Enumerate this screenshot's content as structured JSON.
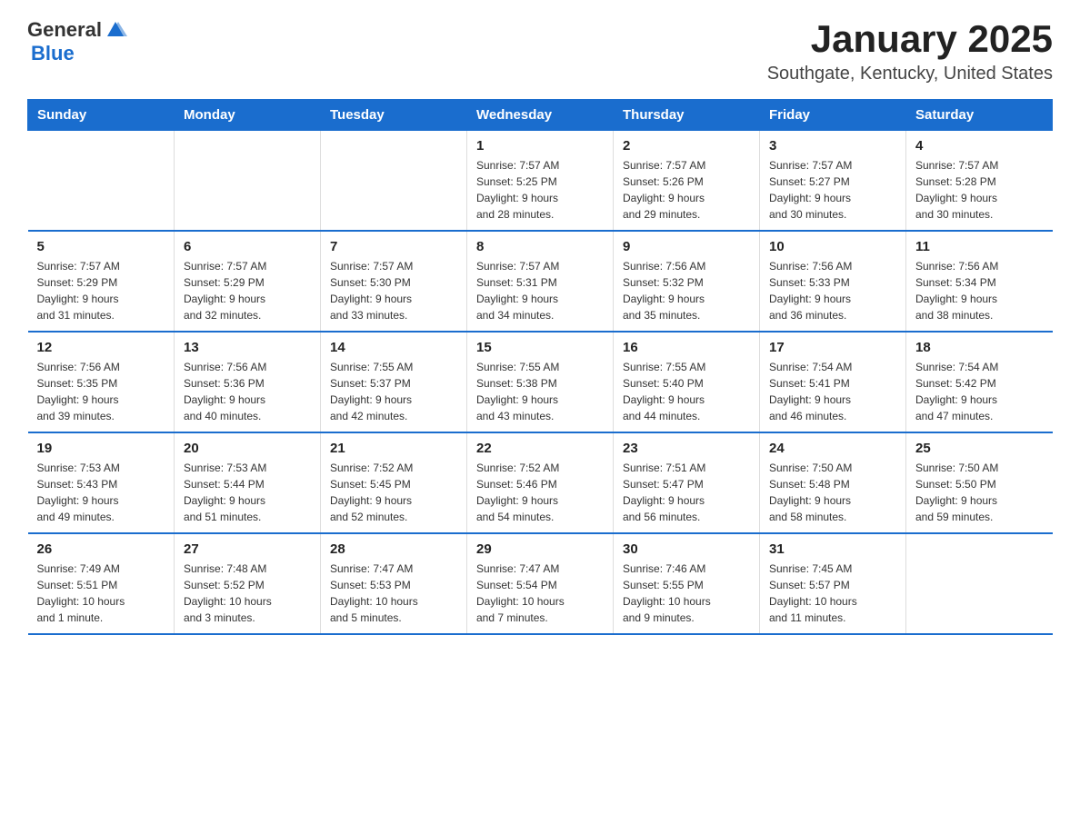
{
  "header": {
    "logo_general": "General",
    "logo_blue": "Blue",
    "title": "January 2025",
    "subtitle": "Southgate, Kentucky, United States"
  },
  "days_of_week": [
    "Sunday",
    "Monday",
    "Tuesday",
    "Wednesday",
    "Thursday",
    "Friday",
    "Saturday"
  ],
  "weeks": [
    [
      {
        "day": "",
        "info": ""
      },
      {
        "day": "",
        "info": ""
      },
      {
        "day": "",
        "info": ""
      },
      {
        "day": "1",
        "info": "Sunrise: 7:57 AM\nSunset: 5:25 PM\nDaylight: 9 hours\nand 28 minutes."
      },
      {
        "day": "2",
        "info": "Sunrise: 7:57 AM\nSunset: 5:26 PM\nDaylight: 9 hours\nand 29 minutes."
      },
      {
        "day": "3",
        "info": "Sunrise: 7:57 AM\nSunset: 5:27 PM\nDaylight: 9 hours\nand 30 minutes."
      },
      {
        "day": "4",
        "info": "Sunrise: 7:57 AM\nSunset: 5:28 PM\nDaylight: 9 hours\nand 30 minutes."
      }
    ],
    [
      {
        "day": "5",
        "info": "Sunrise: 7:57 AM\nSunset: 5:29 PM\nDaylight: 9 hours\nand 31 minutes."
      },
      {
        "day": "6",
        "info": "Sunrise: 7:57 AM\nSunset: 5:29 PM\nDaylight: 9 hours\nand 32 minutes."
      },
      {
        "day": "7",
        "info": "Sunrise: 7:57 AM\nSunset: 5:30 PM\nDaylight: 9 hours\nand 33 minutes."
      },
      {
        "day": "8",
        "info": "Sunrise: 7:57 AM\nSunset: 5:31 PM\nDaylight: 9 hours\nand 34 minutes."
      },
      {
        "day": "9",
        "info": "Sunrise: 7:56 AM\nSunset: 5:32 PM\nDaylight: 9 hours\nand 35 minutes."
      },
      {
        "day": "10",
        "info": "Sunrise: 7:56 AM\nSunset: 5:33 PM\nDaylight: 9 hours\nand 36 minutes."
      },
      {
        "day": "11",
        "info": "Sunrise: 7:56 AM\nSunset: 5:34 PM\nDaylight: 9 hours\nand 38 minutes."
      }
    ],
    [
      {
        "day": "12",
        "info": "Sunrise: 7:56 AM\nSunset: 5:35 PM\nDaylight: 9 hours\nand 39 minutes."
      },
      {
        "day": "13",
        "info": "Sunrise: 7:56 AM\nSunset: 5:36 PM\nDaylight: 9 hours\nand 40 minutes."
      },
      {
        "day": "14",
        "info": "Sunrise: 7:55 AM\nSunset: 5:37 PM\nDaylight: 9 hours\nand 42 minutes."
      },
      {
        "day": "15",
        "info": "Sunrise: 7:55 AM\nSunset: 5:38 PM\nDaylight: 9 hours\nand 43 minutes."
      },
      {
        "day": "16",
        "info": "Sunrise: 7:55 AM\nSunset: 5:40 PM\nDaylight: 9 hours\nand 44 minutes."
      },
      {
        "day": "17",
        "info": "Sunrise: 7:54 AM\nSunset: 5:41 PM\nDaylight: 9 hours\nand 46 minutes."
      },
      {
        "day": "18",
        "info": "Sunrise: 7:54 AM\nSunset: 5:42 PM\nDaylight: 9 hours\nand 47 minutes."
      }
    ],
    [
      {
        "day": "19",
        "info": "Sunrise: 7:53 AM\nSunset: 5:43 PM\nDaylight: 9 hours\nand 49 minutes."
      },
      {
        "day": "20",
        "info": "Sunrise: 7:53 AM\nSunset: 5:44 PM\nDaylight: 9 hours\nand 51 minutes."
      },
      {
        "day": "21",
        "info": "Sunrise: 7:52 AM\nSunset: 5:45 PM\nDaylight: 9 hours\nand 52 minutes."
      },
      {
        "day": "22",
        "info": "Sunrise: 7:52 AM\nSunset: 5:46 PM\nDaylight: 9 hours\nand 54 minutes."
      },
      {
        "day": "23",
        "info": "Sunrise: 7:51 AM\nSunset: 5:47 PM\nDaylight: 9 hours\nand 56 minutes."
      },
      {
        "day": "24",
        "info": "Sunrise: 7:50 AM\nSunset: 5:48 PM\nDaylight: 9 hours\nand 58 minutes."
      },
      {
        "day": "25",
        "info": "Sunrise: 7:50 AM\nSunset: 5:50 PM\nDaylight: 9 hours\nand 59 minutes."
      }
    ],
    [
      {
        "day": "26",
        "info": "Sunrise: 7:49 AM\nSunset: 5:51 PM\nDaylight: 10 hours\nand 1 minute."
      },
      {
        "day": "27",
        "info": "Sunrise: 7:48 AM\nSunset: 5:52 PM\nDaylight: 10 hours\nand 3 minutes."
      },
      {
        "day": "28",
        "info": "Sunrise: 7:47 AM\nSunset: 5:53 PM\nDaylight: 10 hours\nand 5 minutes."
      },
      {
        "day": "29",
        "info": "Sunrise: 7:47 AM\nSunset: 5:54 PM\nDaylight: 10 hours\nand 7 minutes."
      },
      {
        "day": "30",
        "info": "Sunrise: 7:46 AM\nSunset: 5:55 PM\nDaylight: 10 hours\nand 9 minutes."
      },
      {
        "day": "31",
        "info": "Sunrise: 7:45 AM\nSunset: 5:57 PM\nDaylight: 10 hours\nand 11 minutes."
      },
      {
        "day": "",
        "info": ""
      }
    ]
  ]
}
